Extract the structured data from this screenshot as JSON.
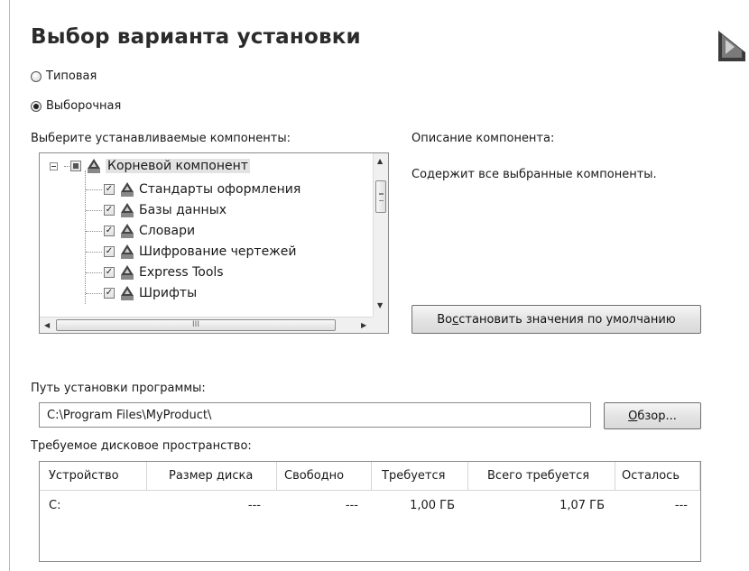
{
  "title": "Выбор варианта установки",
  "install_type": {
    "options": [
      {
        "label": "Типовая",
        "selected": false
      },
      {
        "label": "Выборочная",
        "selected": true
      }
    ]
  },
  "components": {
    "label": "Выберите устанавливаемые компоненты:",
    "root": "Корневой компонент",
    "items": [
      "Стандарты оформления",
      "Базы данных",
      "Словари",
      "Шифрование чертежей",
      "Express Tools",
      "Шрифты"
    ],
    "scroll_grip": "III"
  },
  "description": {
    "label": "Описание компонента:",
    "text": "Содержит все выбранные компоненты."
  },
  "restore_button": {
    "before": "Во",
    "accel": "с",
    "after": "становить значения по умолчанию"
  },
  "install_path": {
    "label": "Путь установки программы:",
    "value": "C:\\Program Files\\MyProduct\\"
  },
  "browse_button": {
    "accel": "О",
    "after": "бзор..."
  },
  "disk_space": {
    "label": "Требуемое дисковое пространство:",
    "columns": [
      "Устройство",
      "Размер диска",
      "Свободно",
      "Требуется",
      "Всего требуется",
      "Осталось"
    ],
    "rows": [
      [
        "C:",
        "---",
        "---",
        "1,00 ГБ",
        "1,07 ГБ",
        "---"
      ]
    ]
  }
}
